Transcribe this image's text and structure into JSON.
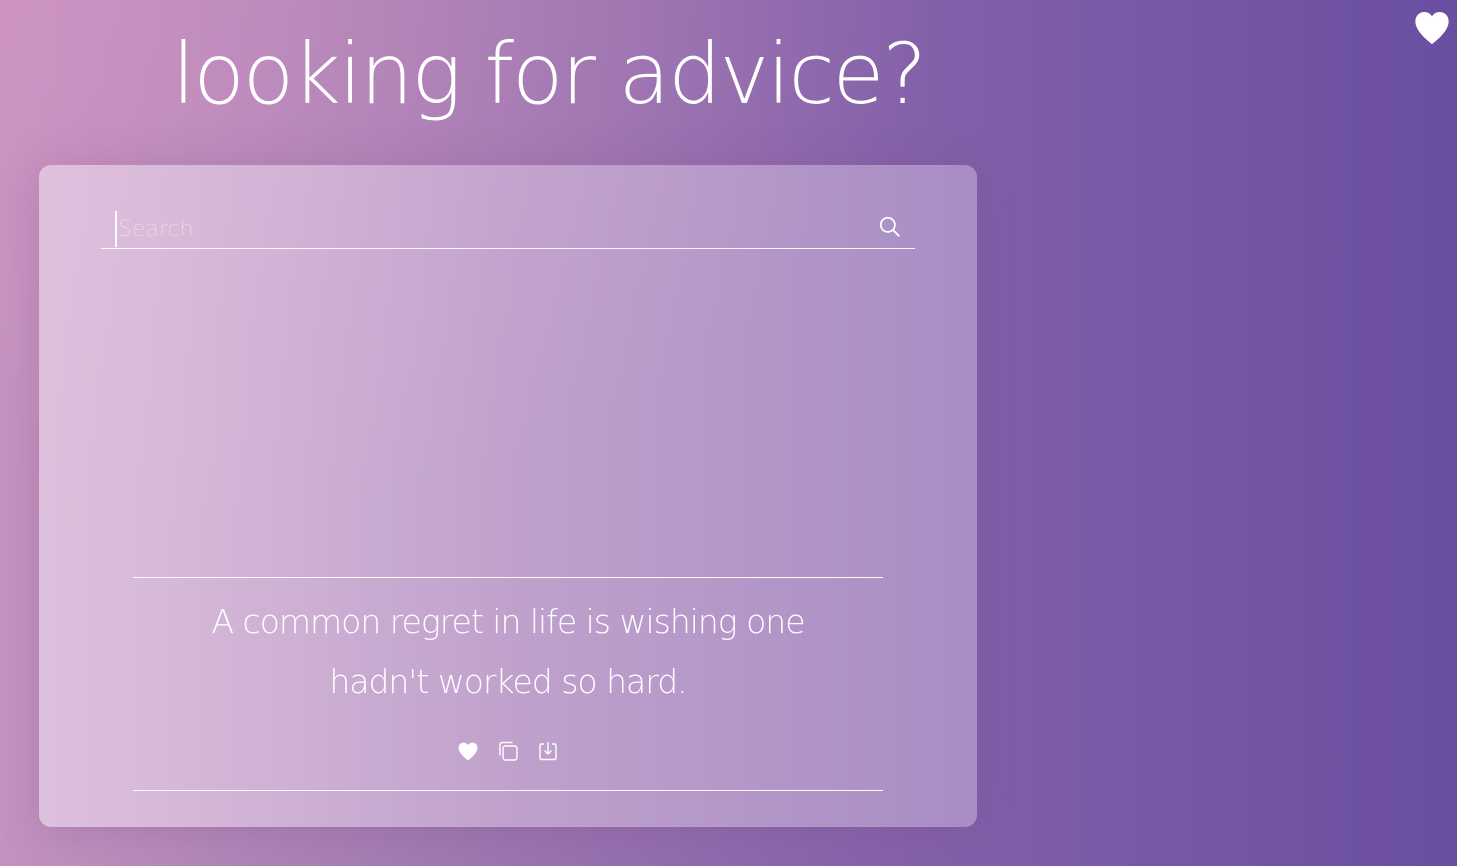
{
  "header": {
    "title": "looking for advice?"
  },
  "search": {
    "placeholder": "Search",
    "value": ""
  },
  "advice": {
    "text": "A common regret in life is wishing one hadn't worked so hard."
  },
  "icons": {
    "favorites": "heart-icon",
    "search": "search-icon",
    "like": "heart-icon",
    "copy": "copy-icon",
    "download": "download-icon"
  },
  "colors": {
    "background_start": "#c493bf",
    "background_end": "#6a4ea0",
    "text": "#ffffff"
  }
}
